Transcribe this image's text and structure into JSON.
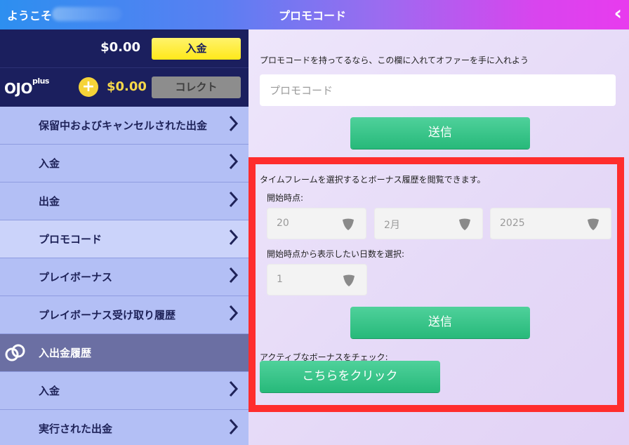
{
  "header": {
    "welcome": "ようこそ",
    "title": "プロモコード",
    "back_icon": "chevron-left-icon"
  },
  "wallet": {
    "balance": "$0.00",
    "deposit_label": "入金",
    "brand": "OJO",
    "brand_sup": "plus",
    "bonus_balance": "$0.00",
    "collect_label": "コレクト"
  },
  "sidebar": {
    "items": [
      {
        "label": "保留中およびキャンセルされた出金"
      },
      {
        "label": "入金"
      },
      {
        "label": "出金"
      },
      {
        "label": "プロモコード"
      },
      {
        "label": "プレイボーナス"
      },
      {
        "label": "プレイボーナス受け取り履歴"
      },
      {
        "label": "入出金履歴"
      },
      {
        "label": "入金"
      },
      {
        "label": "実行された出金"
      }
    ]
  },
  "promo": {
    "description": "プロモコードを持ってるなら、この欄に入れてオファーを手に入れよう",
    "placeholder": "プロモコード",
    "submit_label": "送信"
  },
  "history": {
    "description": "タイムフレームを選択するとボーナス履歴を閲覧できます。",
    "start_label": "開始時点:",
    "day": "20",
    "month": "2月",
    "year": "2025",
    "days_label": "開始時点から表示したい日数を選択:",
    "days": "1",
    "submit_label": "送信",
    "active_label": "アクティブなボーナスをチェック:",
    "click_label": "こちらをクリック"
  },
  "colors": {
    "highlight": "#ff2d2d",
    "sidebar_dark": "#1b1f5e",
    "accent_green": "#27b97a",
    "deposit_yellow": "#ffe81a"
  }
}
